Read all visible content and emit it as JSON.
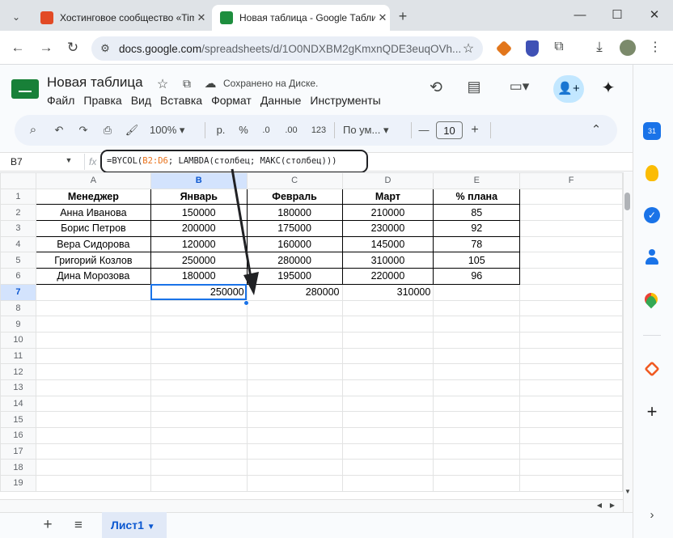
{
  "browser": {
    "tabs": [
      {
        "title": "Хостинговое сообщество «Tim",
        "active": false
      },
      {
        "title": "Новая таблица - Google Табли",
        "active": true
      }
    ],
    "url_domain": "docs.google.com",
    "url_path": "/spreadsheets/d/1O0NDXBM2gKmxnQDE3euqOVh..."
  },
  "doc": {
    "title": "Новая таблица",
    "save_status": "Сохранено на Диске.",
    "menu": [
      "Файл",
      "Правка",
      "Вид",
      "Вставка",
      "Формат",
      "Данные",
      "Инструменты"
    ]
  },
  "toolbar": {
    "zoom": "100%",
    "currency": "р.",
    "percent": "%",
    "dec_less": ".0",
    "dec_more": ".00",
    "number_format": "123",
    "font": "По ум...",
    "font_size": "10"
  },
  "formula_bar": {
    "name_box": "B7",
    "fx": "fx",
    "formula_prefix": "=BYCOL(",
    "formula_range": "B2:D6",
    "formula_suffix": "; LAMBDA(столбец; МАКС(столбец)))"
  },
  "sheet": {
    "columns": [
      "A",
      "B",
      "C",
      "D",
      "E",
      "F"
    ],
    "rows": [
      "1",
      "2",
      "3",
      "4",
      "5",
      "6",
      "7",
      "8",
      "9",
      "10",
      "11",
      "12",
      "13",
      "14",
      "15",
      "16",
      "17",
      "18",
      "19"
    ],
    "header": [
      "Менеджер",
      "Январь",
      "Февраль",
      "Март",
      "% плана"
    ],
    "data": [
      [
        "Анна Иванова",
        "150000",
        "180000",
        "210000",
        "85"
      ],
      [
        "Борис Петров",
        "200000",
        "175000",
        "230000",
        "92"
      ],
      [
        "Вера Сидорова",
        "120000",
        "160000",
        "145000",
        "78"
      ],
      [
        "Григорий Козлов",
        "250000",
        "280000",
        "310000",
        "105"
      ],
      [
        "Дина Морозова",
        "180000",
        "195000",
        "220000",
        "96"
      ]
    ],
    "result_row": [
      "250000",
      "280000",
      "310000"
    ],
    "selected_cell": "B7"
  },
  "bottom": {
    "add_sheet": "+",
    "all_sheets": "≡",
    "sheet_tab": "Лист1"
  },
  "colors": {
    "accent": "#1a73e8",
    "sheets_green": "#188038",
    "range_orange": "#e8711a"
  }
}
